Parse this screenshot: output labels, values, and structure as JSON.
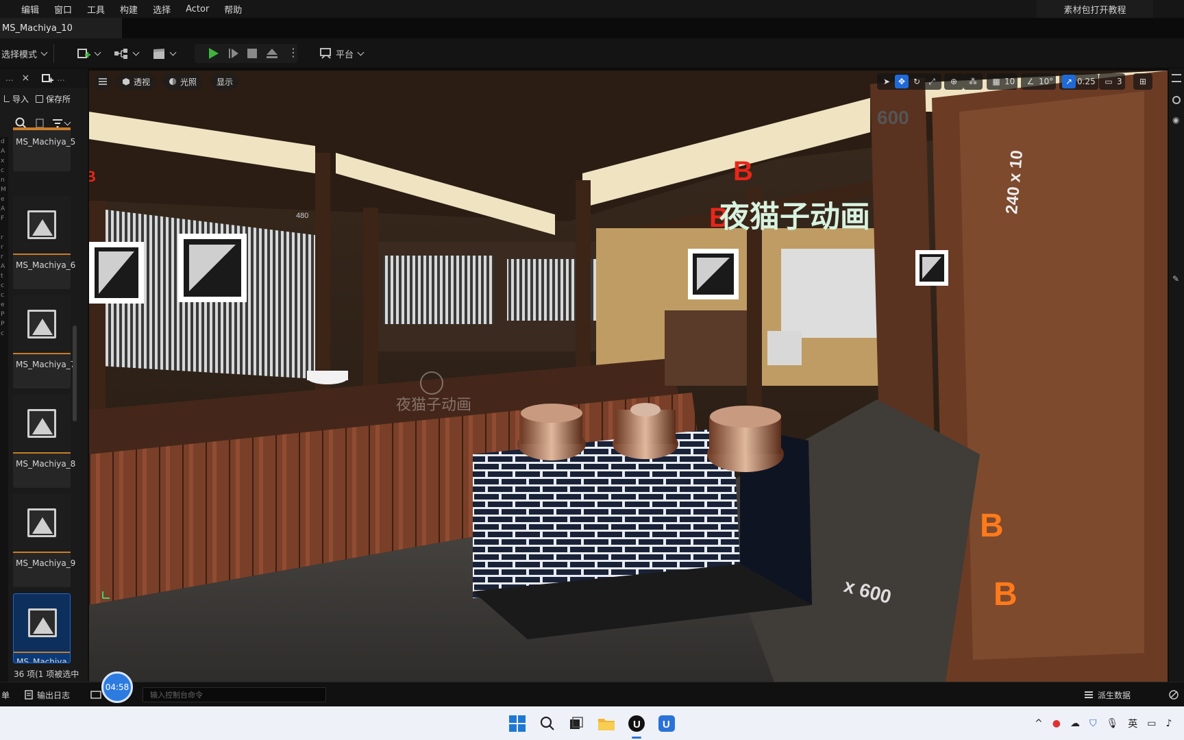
{
  "menubar": {
    "items": [
      "编辑",
      "窗口",
      "工具",
      "构建",
      "选择",
      "Actor",
      "帮助"
    ],
    "tutorial": "素材包打开教程"
  },
  "tab": {
    "title": "MS_Machiya_10"
  },
  "toolbar": {
    "mode": "选择模式",
    "platform": "平台"
  },
  "left_panel": {
    "header_dots": "...",
    "header_close": "×",
    "import": "导入",
    "save_all": "保存所",
    "assets": [
      "MS_Machiya_5",
      "MS_Machiya_6",
      "MS_Machiya_7",
      "MS_Machiya_8",
      "MS_Machiya_9",
      "MS_Machiya"
    ],
    "item_count": "36 项(1 项被选中"
  },
  "viewport": {
    "perspective": "透视",
    "lighting": "光照",
    "show": "显示",
    "grid_snap": "10",
    "rotation_snap": "10°",
    "scale_snap": "0.25",
    "camera_speed": "3",
    "scene_labels": {
      "dim_600": "600",
      "dim_240x10": "240 x 10",
      "dim_480": "480",
      "floor_dims": "x 600",
      "sign": "夜猫子动画",
      "watermark": "夜猫子动画"
    }
  },
  "bottom_bar": {
    "left_label": "单",
    "output_log": "输出日志",
    "console_placeholder": "输入控制台命令",
    "derived_data": "派生数据",
    "timer": "04:58"
  },
  "taskbar": {
    "ime": "英"
  },
  "colors": {
    "accent_blue": "#1f6ad6",
    "asset_underline": "#c97d2a",
    "play_green": "#3fb43f",
    "marker_red": "#e8261a"
  }
}
